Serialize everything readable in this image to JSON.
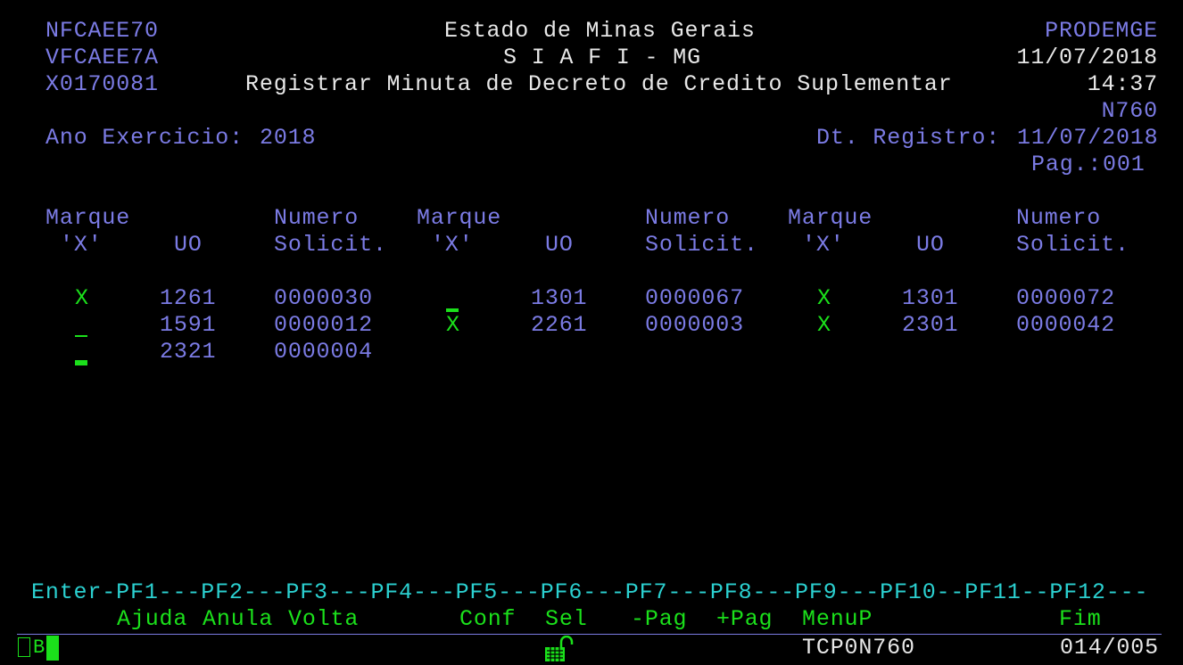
{
  "header": {
    "left": [
      "NFCAEE70",
      "VFCAEE7A",
      "X0170081"
    ],
    "center": [
      "Estado de Minas Gerais",
      "S I A F I - MG",
      "Registrar Minuta de Decreto de Credito Suplementar"
    ],
    "right": [
      "PRODEMGE",
      "11/07/2018",
      "14:37",
      "N760"
    ]
  },
  "ano_exercicio": {
    "label": "Ano Exercicio:",
    "value": "2018"
  },
  "dt_registro": {
    "label": "Dt. Registro:",
    "value": "11/07/2018"
  },
  "pagina": {
    "label": "Pag.:",
    "value": "001"
  },
  "columns": {
    "marque": "Marque",
    "x_label": "'X'",
    "uo": "UO",
    "numero": "Numero",
    "solicit": "Solicit."
  },
  "entries": [
    {
      "mark": "X",
      "uo": "1261",
      "numero": "0000030"
    },
    {
      "mark": "",
      "uo": "1591",
      "numero": "0000012"
    },
    {
      "mark": "",
      "uo": "2321",
      "numero": "0000004"
    },
    {
      "mark": "",
      "uo": "1301",
      "numero": "0000067"
    },
    {
      "mark": "X",
      "uo": "2261",
      "numero": "0000003"
    },
    {
      "mark": "X",
      "uo": "1301",
      "numero": "0000072"
    },
    {
      "mark": "X",
      "uo": "2301",
      "numero": "0000042"
    }
  ],
  "pf_keys": {
    "line": "Enter-PF1---PF2---PF3---PF4---PF5---PF6---PF7---PF8---PF9---PF10--PF11--PF12---",
    "labels": {
      "pf1": "Ajuda",
      "pf2": "Anula",
      "pf3": "Volta",
      "pf5": "Conf",
      "pf6": "Sel",
      "pf7": "-Pag",
      "pf8": "+Pag",
      "pf9": "MenuP",
      "pf12": "Fim"
    }
  },
  "status": {
    "session_indicator": "B",
    "terminal_id": "TCP0N760",
    "cursor_pos": "014/005"
  },
  "colors": {
    "protected": "#7B7BE4",
    "title": "#E8E8E8",
    "input": "#1BE01B",
    "pfline": "#2BD0D0"
  }
}
